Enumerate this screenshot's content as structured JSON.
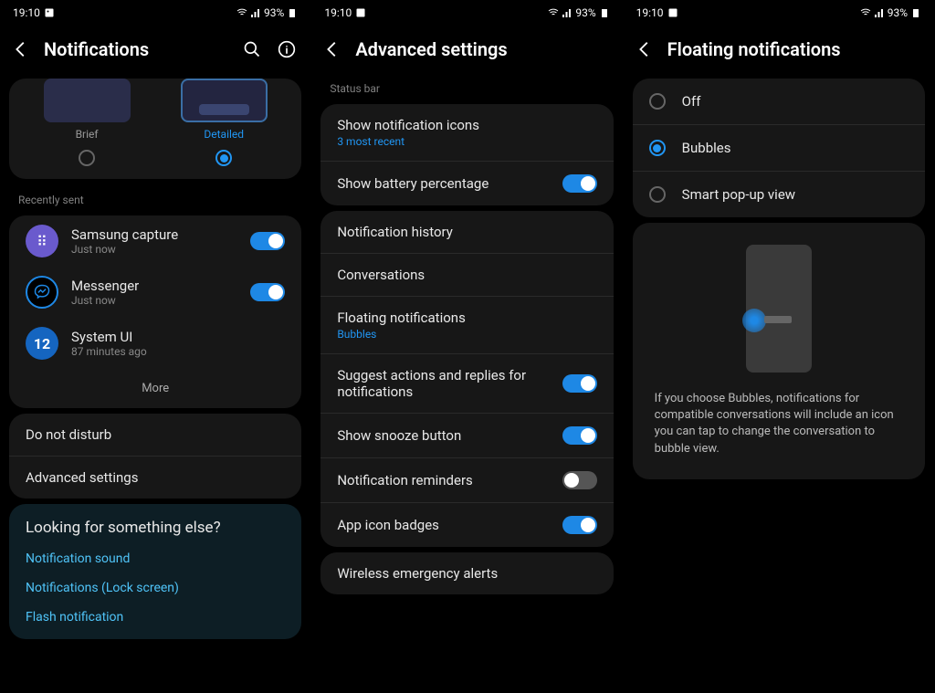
{
  "status": {
    "time": "19:10",
    "battery": "93%"
  },
  "screen1": {
    "title": "Notifications",
    "style": {
      "brief": "Brief",
      "detailed": "Detailed"
    },
    "recently_sent_label": "Recently sent",
    "apps": [
      {
        "name": "Samsung capture",
        "time": "Just now"
      },
      {
        "name": "Messenger",
        "time": "Just now"
      },
      {
        "name": "System UI",
        "time": "87 minutes ago"
      }
    ],
    "more": "More",
    "dnd": "Do not disturb",
    "advanced": "Advanced settings",
    "looking_title": "Looking for something else?",
    "links": [
      "Notification sound",
      "Notifications (Lock screen)",
      "Flash notification"
    ]
  },
  "screen2": {
    "title": "Advanced settings",
    "status_bar_label": "Status bar",
    "show_icons": {
      "title": "Show notification icons",
      "sub": "3 most recent"
    },
    "show_battery": "Show battery percentage",
    "history": "Notification history",
    "conversations": "Conversations",
    "floating": {
      "title": "Floating notifications",
      "sub": "Bubbles"
    },
    "suggest": "Suggest actions and replies for notifications",
    "snooze": "Show snooze button",
    "reminders": "Notification reminders",
    "badges": "App icon badges",
    "wireless": "Wireless emergency alerts"
  },
  "screen3": {
    "title": "Floating notifications",
    "options": {
      "off": "Off",
      "bubbles": "Bubbles",
      "smart": "Smart pop-up view"
    },
    "description": "If you choose Bubbles, notifications for compatible conversations will include an icon you can tap to change the conversation to bubble view."
  }
}
